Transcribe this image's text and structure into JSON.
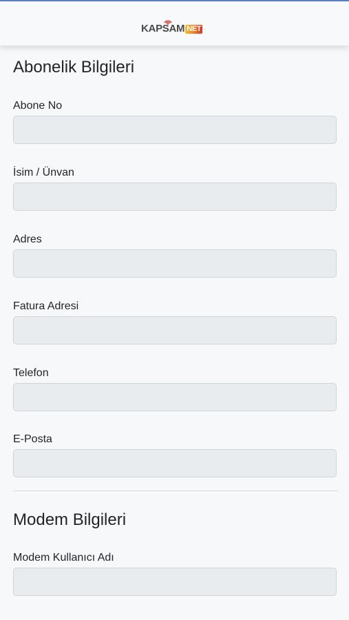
{
  "header": {
    "logo_main": "KAPSAM",
    "logo_suffix": "NET"
  },
  "subscription": {
    "title": "Abonelik Bilgileri",
    "fields": [
      {
        "label": "Abone No",
        "value": ""
      },
      {
        "label": "İsim / Ünvan",
        "value": ""
      },
      {
        "label": "Adres",
        "value": ""
      },
      {
        "label": "Fatura Adresi",
        "value": ""
      },
      {
        "label": "Telefon",
        "value": ""
      },
      {
        "label": "E-Posta",
        "value": ""
      }
    ]
  },
  "modem": {
    "title": "Modem Bilgileri",
    "fields": [
      {
        "label": "Modem Kullanıcı Adı",
        "value": ""
      }
    ]
  },
  "colors": {
    "input_background": "#e9ecef",
    "input_border": "#ced4da",
    "page_background": "#f6f8fa",
    "logo_accent": "#f08a1f"
  },
  "icons": {
    "logo_signal": "wifi-signal-icon"
  }
}
